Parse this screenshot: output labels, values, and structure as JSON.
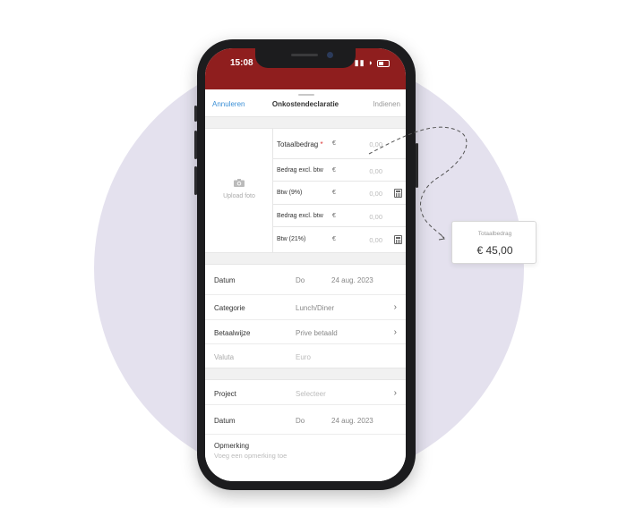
{
  "status_bar": {
    "time": "15:08"
  },
  "nav": {
    "cancel": "Annuleren",
    "title": "Onkostendeclaratie",
    "submit": "Indienen"
  },
  "upload": {
    "label": "Upload foto"
  },
  "amounts": {
    "total": {
      "label": "Totaalbedrag",
      "required_mark": "*",
      "currency": "€",
      "value": "0,00"
    },
    "rows": [
      {
        "label": "Bedrag excl. btw",
        "currency": "€",
        "value": "0,00"
      },
      {
        "label": "Btw (9%)",
        "currency": "€",
        "value": "0,00"
      },
      {
        "label": "Bedrag excl. btw",
        "currency": "€",
        "value": "0,00"
      },
      {
        "label": "Btw (21%)",
        "currency": "€",
        "value": "0,00"
      }
    ]
  },
  "fields": {
    "datum": {
      "label": "Datum",
      "day": "Do",
      "date": "24 aug. 2023"
    },
    "categorie": {
      "label": "Categorie",
      "value": "Lunch/Diner"
    },
    "betaalwijze": {
      "label": "Betaalwijze",
      "value": "Prive betaald"
    },
    "valuta": {
      "label": "Valuta",
      "value": "Euro"
    },
    "project": {
      "label": "Project",
      "value": "Selecteer"
    },
    "datum2": {
      "label": "Datum",
      "day": "Do",
      "date": "24 aug. 2023"
    },
    "opmerking": {
      "label": "Opmerking",
      "placeholder": "Voeg een opmerking toe"
    }
  },
  "callout": {
    "label": "Totaalbedrag",
    "value": "€ 45,00"
  },
  "colors": {
    "header": "#8f1e1e",
    "accent": "#3a8fd6",
    "background_circle": "#e4e1ee"
  },
  "icons": {
    "upload": "camera-icon",
    "calculator": "calculator-icon",
    "chevron": "chevron-right-icon"
  }
}
